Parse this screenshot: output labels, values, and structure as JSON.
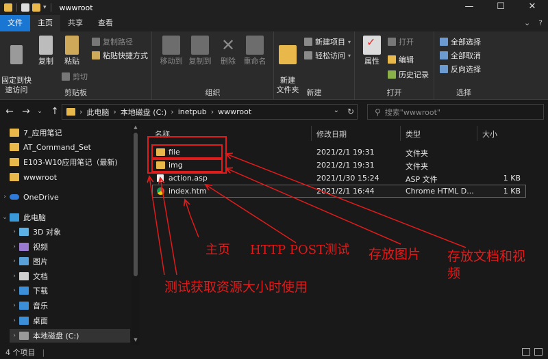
{
  "window": {
    "title": "wwwroot",
    "controls": [
      "—",
      "☐",
      "✕"
    ]
  },
  "tabs": {
    "file": "文件",
    "items": [
      "主页",
      "共享",
      "查看"
    ],
    "help": "?",
    "expand": "⌄"
  },
  "ribbon": {
    "clipboard": {
      "label": "剪贴板",
      "pin": "固定到快\n速访问",
      "copy": "复制",
      "paste": "粘贴",
      "copy_path": "复制路径",
      "paste_shortcut": "粘贴快捷方式",
      "cut": "剪切"
    },
    "organize": {
      "label": "组织",
      "move_to": "移动到",
      "copy_to": "复制到",
      "delete": "删除",
      "rename": "重命名"
    },
    "new": {
      "label": "新建",
      "new_folder": "新建\n文件夹",
      "new_item": "新建项目",
      "easy_access": "轻松访问"
    },
    "open": {
      "label": "打开",
      "properties": "属性",
      "open": "打开",
      "edit": "编辑",
      "history": "历史记录"
    },
    "select": {
      "label": "选择",
      "select_all": "全部选择",
      "select_none": "全部取消",
      "invert": "反向选择"
    }
  },
  "address": {
    "crumbs": [
      "此电脑",
      "本地磁盘 (C:)",
      "inetpub",
      "wwwroot"
    ],
    "search_placeholder": "搜索\"wwwroot\""
  },
  "sidebar": {
    "items": [
      {
        "label": "7_应用笔记",
        "icon": "folder-icon"
      },
      {
        "label": "AT_Command_Set",
        "icon": "folder-icon"
      },
      {
        "label": "E103-W10应用笔记（最新)",
        "icon": "folder-icon"
      },
      {
        "label": "wwwroot",
        "icon": "folder-icon"
      },
      {
        "label": "OneDrive",
        "icon": "cloud-icon"
      },
      {
        "label": "此电脑",
        "icon": "computer-icon"
      },
      {
        "label": "3D 对象",
        "icon": "cube-icon"
      },
      {
        "label": "视频",
        "icon": "video-icon"
      },
      {
        "label": "图片",
        "icon": "picture-icon"
      },
      {
        "label": "文档",
        "icon": "document-icon"
      },
      {
        "label": "下载",
        "icon": "download-icon"
      },
      {
        "label": "音乐",
        "icon": "music-icon"
      },
      {
        "label": "桌面",
        "icon": "desktop-icon"
      },
      {
        "label": "本地磁盘 (C:)",
        "icon": "drive-icon"
      }
    ]
  },
  "filelist": {
    "columns": [
      "名称",
      "修改日期",
      "类型",
      "大小"
    ],
    "rows": [
      {
        "name": "file",
        "date": "2021/2/1 19:31",
        "type": "文件夹",
        "size": "",
        "icon": "folder-icon"
      },
      {
        "name": "img",
        "date": "2021/2/1 19:31",
        "type": "文件夹",
        "size": "",
        "icon": "folder-icon"
      },
      {
        "name": "action.asp",
        "date": "2021/1/30 15:24",
        "type": "ASP 文件",
        "size": "1 KB",
        "icon": "file-icon"
      },
      {
        "name": "index.htm",
        "date": "2021/2/1 16:44",
        "type": "Chrome HTML D...",
        "size": "1 KB",
        "icon": "chrome-icon"
      }
    ]
  },
  "status": {
    "count": "4 个项目"
  },
  "annotations": {
    "home": "主页",
    "post": "HTTP POST测试",
    "images": "存放图片",
    "docs": "存放文档和视",
    "docs_cont": "频",
    "size": "测试获取资源大小时使用"
  },
  "colors": {
    "accent": "#1976d2",
    "folder": "#e8b84a",
    "annotation": "#e01b1b",
    "background": "#191919",
    "ribbon": "#2b2b2b"
  }
}
